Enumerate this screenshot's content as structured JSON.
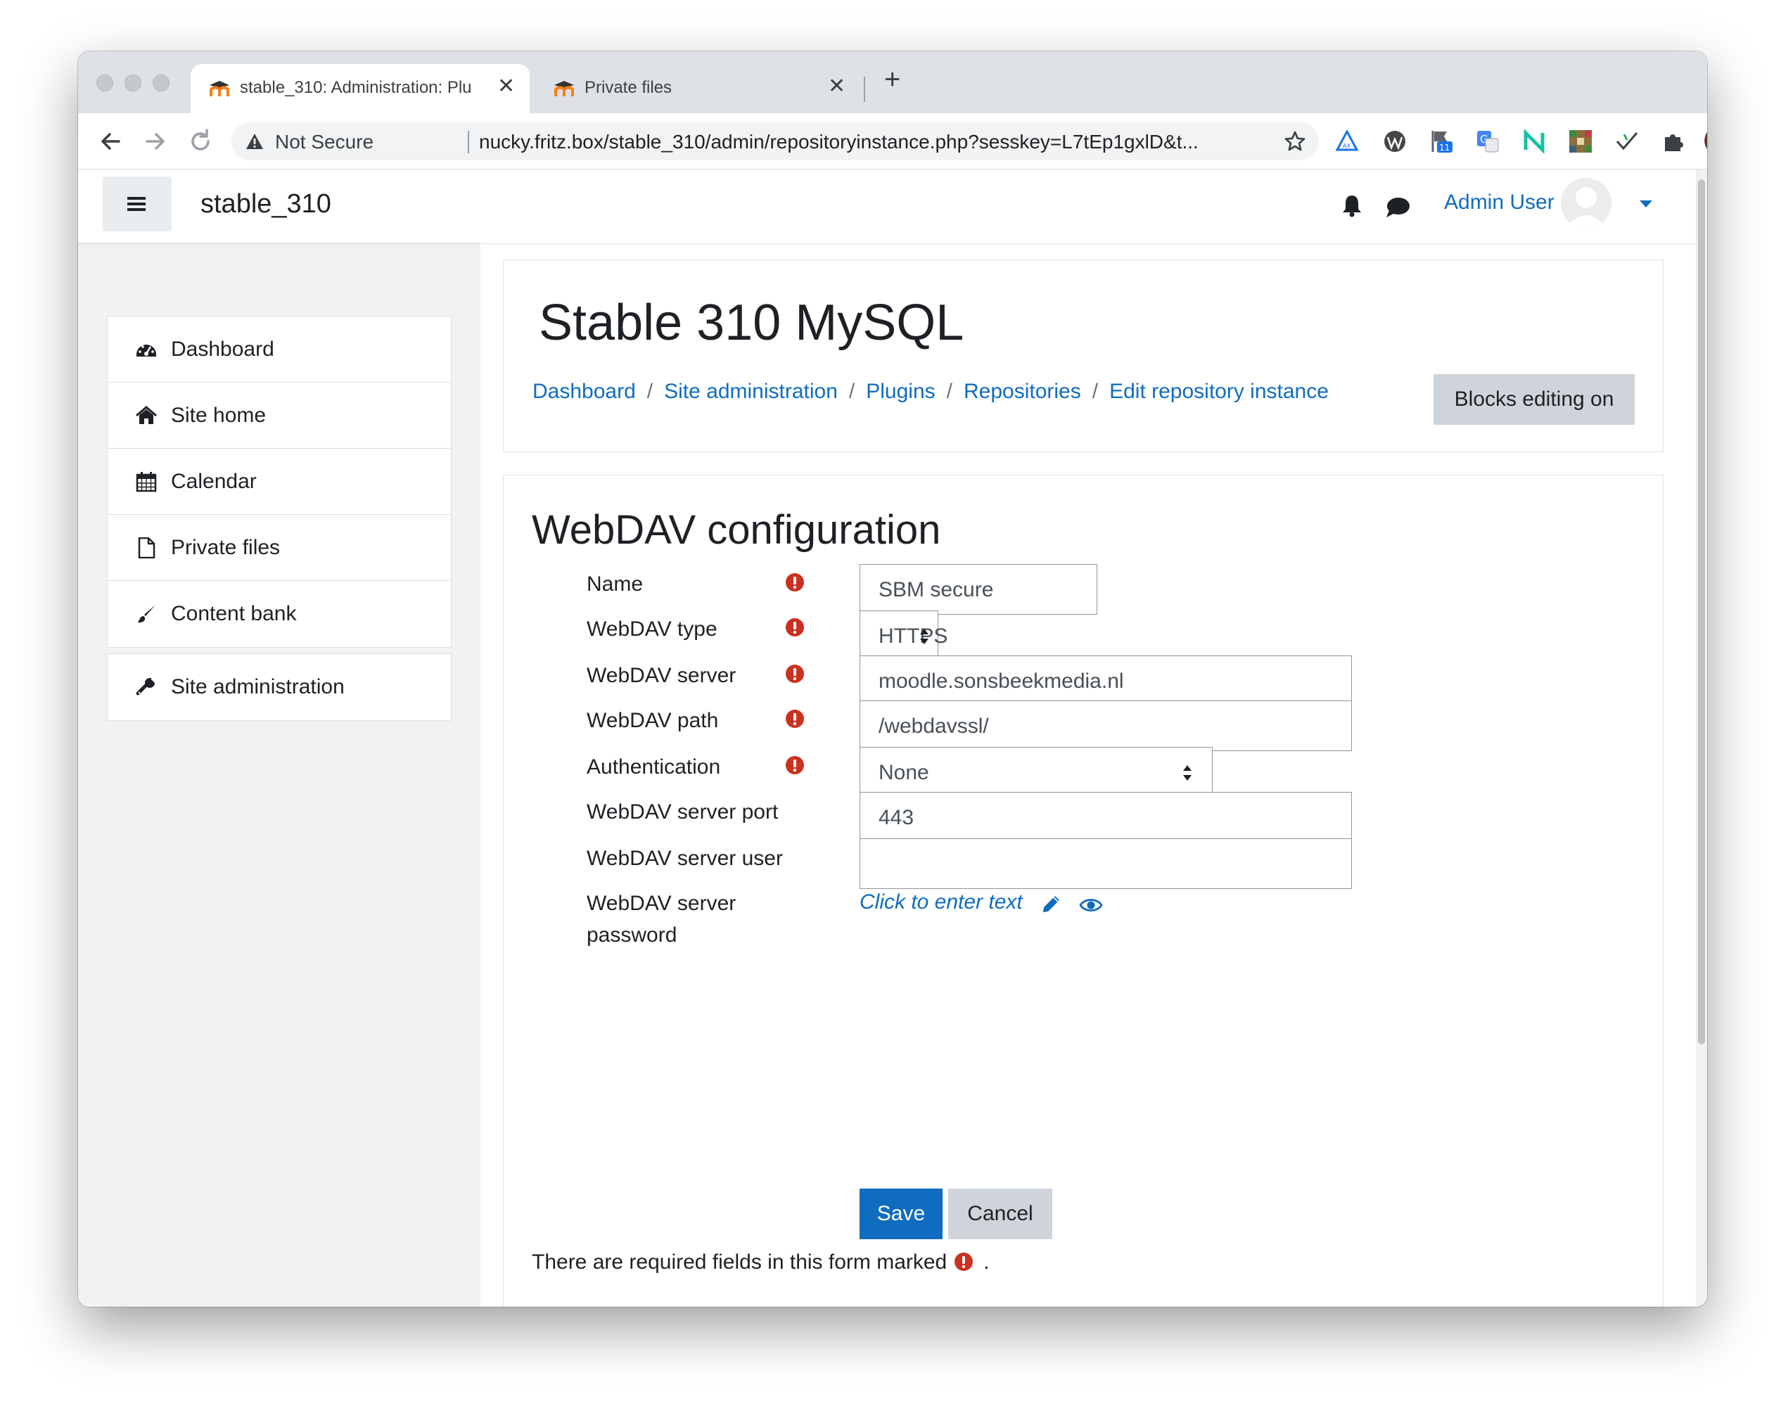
{
  "browser": {
    "tabs": [
      {
        "title": "stable_310: Administration: Plu",
        "active": true
      },
      {
        "title": "Private files",
        "active": false
      }
    ],
    "security_label": "Not Secure",
    "url": "nucky.fritz.box/stable_310/admin/repositoryinstance.php?sesskey=L7tEp1gxlD&t...",
    "extension_badge": "11"
  },
  "navbar": {
    "site_name": "stable_310",
    "user_name": "Admin User"
  },
  "drawer": {
    "items": [
      {
        "label": "Dashboard",
        "icon": "dashboard-icon"
      },
      {
        "label": "Site home",
        "icon": "home-icon"
      },
      {
        "label": "Calendar",
        "icon": "calendar-icon"
      },
      {
        "label": "Private files",
        "icon": "file-icon"
      },
      {
        "label": "Content bank",
        "icon": "paintbrush-icon"
      }
    ],
    "admin_item": {
      "label": "Site administration",
      "icon": "wrench-icon"
    }
  },
  "header": {
    "title": "Stable 310 MySQL",
    "breadcrumb": [
      "Dashboard",
      "Site administration",
      "Plugins",
      "Repositories",
      "Edit repository instance"
    ],
    "blocks_button": "Blocks editing on"
  },
  "form": {
    "title": "WebDAV configuration",
    "fields": {
      "name": {
        "label": "Name",
        "value": "SBM secure",
        "required": true
      },
      "type": {
        "label": "WebDAV type",
        "value": "HTTPS",
        "required": true
      },
      "server": {
        "label": "WebDAV server",
        "value": "moodle.sonsbeekmedia.nl",
        "required": true
      },
      "path": {
        "label": "WebDAV path",
        "value": "/webdavssl/",
        "required": true
      },
      "auth": {
        "label": "Authentication",
        "value": "None",
        "required": true
      },
      "port": {
        "label": "WebDAV server port",
        "value": "443",
        "required": false
      },
      "user": {
        "label": "WebDAV server user",
        "value": "",
        "required": false
      },
      "password": {
        "label_line1": "WebDAV server",
        "label_line2": "password",
        "placeholder": "Click to enter text",
        "required": false
      }
    },
    "save_label": "Save",
    "cancel_label": "Cancel",
    "required_note": "There are required fields in this form marked",
    "required_note_end": "."
  },
  "colors": {
    "link": "#0f6cbf",
    "required": "#ca3120",
    "primary_button": "#0f6cbf",
    "secondary_button": "#ced4da"
  }
}
